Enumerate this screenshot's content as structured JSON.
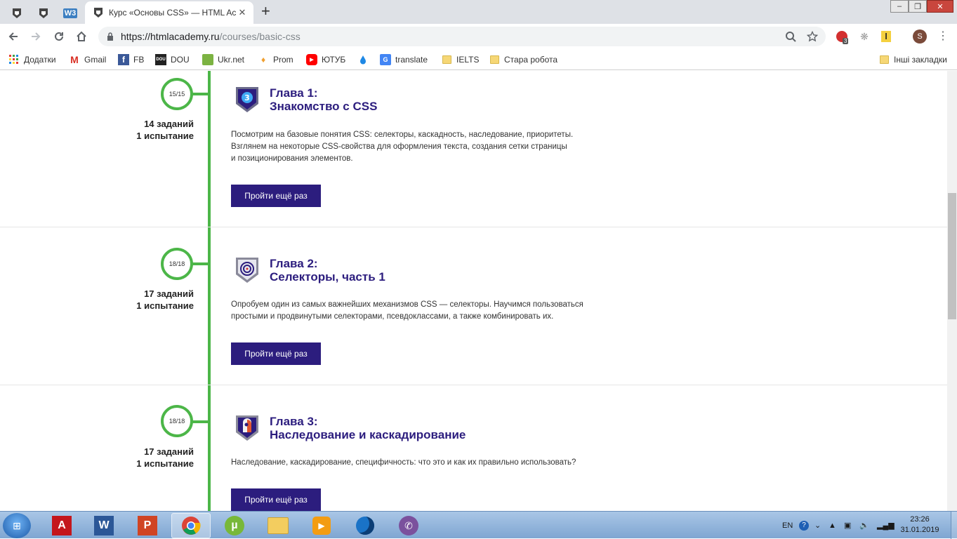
{
  "browser": {
    "tabs": [
      {
        "label": ""
      },
      {
        "label": ""
      },
      {
        "label": "W3"
      },
      {
        "label": "Курс «Основы CSS» — HTML Ac"
      }
    ],
    "url_host": "https://htmlacademy.ru",
    "url_path": "/courses/basic-css",
    "extension_badge": "3",
    "profile_initial": "S",
    "bookmarks": [
      {
        "label": "Додатки",
        "icon": "apps-icon"
      },
      {
        "label": "Gmail",
        "icon": "gmail-icon"
      },
      {
        "label": "FB",
        "icon": "facebook-icon"
      },
      {
        "label": "DOU",
        "icon": "dou-icon"
      },
      {
        "label": "Ukr.net",
        "icon": "ukrnet-icon"
      },
      {
        "label": "Prom",
        "icon": "prom-icon"
      },
      {
        "label": "ЮТУБ",
        "icon": "youtube-icon"
      },
      {
        "label": "",
        "icon": "drop-icon"
      },
      {
        "label": "translate",
        "icon": "translate-icon"
      },
      {
        "label": "IELTS",
        "icon": "folder-icon"
      },
      {
        "label": "Стара робота",
        "icon": "folder-icon"
      }
    ],
    "other_bookmarks": "Інші закладки",
    "dou_icon_text": "DOU"
  },
  "chapters": [
    {
      "progress": "15/15",
      "tasks": "14 заданий",
      "trials": "1 испытание",
      "title_line1": "Глава 1:",
      "title_line2": "Знакомство с CSS",
      "desc_line1": "Посмотрим на базовые понятия CSS: селекторы, каскадность, наследование, приоритеты.",
      "desc_line2": "Взглянем на некоторые CSS-свойства для оформления текста, создания сетки страницы",
      "desc_line3": "и позиционирования элементов.",
      "button": "Пройти ещё раз"
    },
    {
      "progress": "18/18",
      "tasks": "17 заданий",
      "trials": "1 испытание",
      "title_line1": "Глава 2:",
      "title_line2": "Селекторы, часть 1",
      "desc_line1": "Опробуем один из самых важнейших механизмов CSS — селекторы. Научимся пользоваться",
      "desc_line2": "простыми и продвинутыми селекторами, псевдоклассами, а также комбинировать их.",
      "desc_line3": "",
      "button": "Пройти ещё раз"
    },
    {
      "progress": "18/18",
      "tasks": "17 заданий",
      "trials": "1 испытание",
      "title_line1": "Глава 3:",
      "title_line2": "Наследование и каскадирование",
      "desc_line1": "Наследование, каскадирование, специфичность: что это и как их правильно использовать?",
      "desc_line2": "",
      "desc_line3": "",
      "button": "Пройти ещё раз"
    }
  ],
  "taskbar": {
    "language": "EN",
    "time": "23:26",
    "date": "31.01.2019"
  },
  "colors": {
    "accent_green": "#4cb648",
    "brand_purple": "#2c1d7e"
  }
}
